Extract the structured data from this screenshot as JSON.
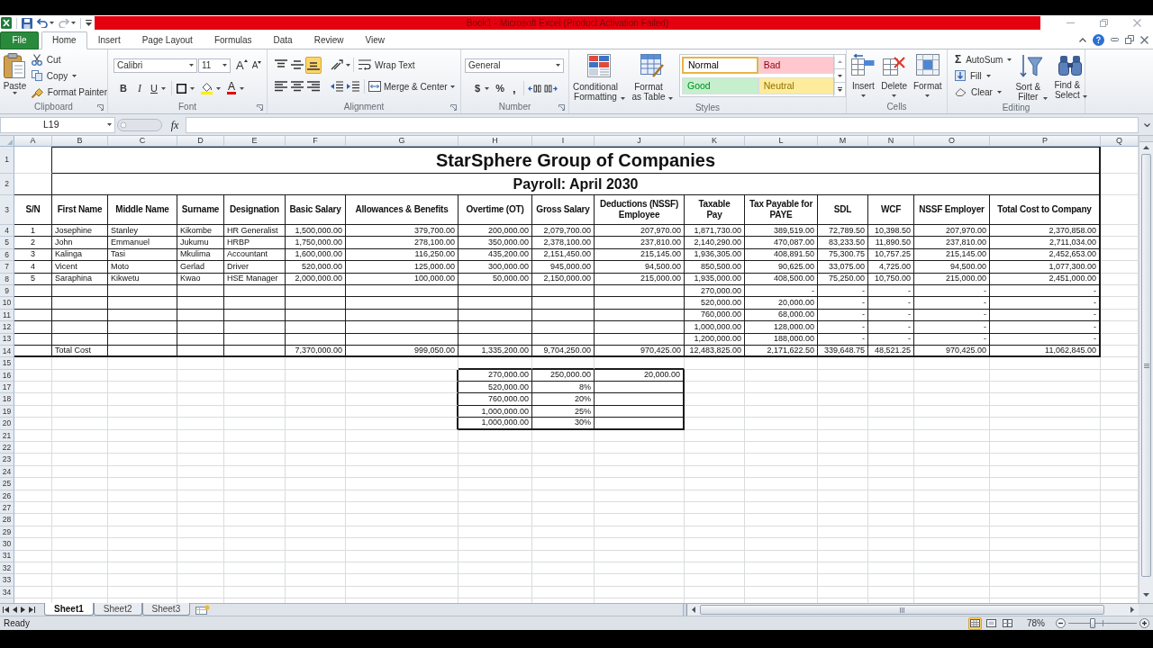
{
  "title_bar": {
    "title": "Book1 - Microsoft Excel (Product Activation Failed)",
    "quick_access": {
      "redo": {
        "disabled": true
      }
    }
  },
  "ribbon": {
    "tabs": [
      {
        "label": "File",
        "kind": "file",
        "selected": false
      },
      {
        "label": "Home",
        "kind": "tab",
        "selected": true
      },
      {
        "label": "Insert",
        "kind": "tab",
        "selected": false
      },
      {
        "label": "Page Layout",
        "kind": "tab",
        "selected": false
      },
      {
        "label": "Formulas",
        "kind": "tab",
        "selected": false
      },
      {
        "label": "Data",
        "kind": "tab",
        "selected": false
      },
      {
        "label": "Review",
        "kind": "tab",
        "selected": false
      },
      {
        "label": "View",
        "kind": "tab",
        "selected": false
      }
    ],
    "clipboard": {
      "label": "Clipboard",
      "paste": "Paste",
      "cut": "Cut",
      "copy": "Copy",
      "format_painter": "Format Painter"
    },
    "font": {
      "label": "Font",
      "font_name": "Calibri",
      "font_size": "11",
      "grow_font": "A",
      "shrink_font": "A",
      "bold": "B",
      "italic": "I",
      "underline": "U",
      "font_color": "A"
    },
    "alignment": {
      "label": "Alignment",
      "vertical_align": [
        {
          "selected": false
        },
        {
          "selected": false
        },
        {
          "selected": true
        }
      ],
      "wrap_text": "Wrap Text",
      "merge_center": "Merge & Center"
    },
    "number": {
      "label": "Number",
      "format": "General",
      "currency": "$",
      "percent": "%",
      "comma": ","
    },
    "styles": {
      "label": "Styles",
      "conditional_formatting": "Conditional Formatting",
      "format_as_table": "Format as Table",
      "gallery": [
        {
          "name": "Normal",
          "color": "#ffffff",
          "selected": true
        },
        {
          "name": "Bad",
          "color": "#ffc7ce",
          "selected": false
        },
        {
          "name": "Good",
          "color": "#c6efce",
          "selected": false
        },
        {
          "name": "Neutral",
          "color": "#ffeb9c",
          "selected": false
        }
      ]
    },
    "cells": {
      "label": "Cells",
      "buttons": [
        "Insert",
        "Delete",
        "Format"
      ]
    },
    "editing": {
      "label": "Editing",
      "sum_symbol": "Σ",
      "autosum": "AutoSum",
      "fill": "Fill",
      "clear": "Clear",
      "sort_filter": "Sort & Filter",
      "find_select": "Find & Select"
    }
  },
  "formula_bar": {
    "name_box": "L19",
    "fx": "fx"
  },
  "sheet": {
    "column_headers": [
      "A",
      "B",
      "C",
      "D",
      "E",
      "F",
      "G",
      "H",
      "I",
      "J",
      "K",
      "L",
      "M",
      "N",
      "O",
      "P",
      "Q"
    ],
    "row_headers": [
      "1",
      "2",
      "3",
      "4",
      "5",
      "6",
      "7",
      "8",
      "9",
      "10",
      "11",
      "12",
      "13",
      "14",
      "15",
      "16",
      "17",
      "18",
      "19",
      "20",
      "21",
      "22",
      "23",
      "24",
      "25",
      "26",
      "27",
      "28",
      "29",
      "30",
      "31",
      "32",
      "33",
      "34"
    ],
    "payroll": {
      "title": "StarSphere Group of Companies",
      "subtitle": "Payroll: April 2030",
      "headers": [
        "S/N",
        "First Name",
        "Middle Name",
        "Surname",
        "Designation",
        "Basic Salary",
        "Allowances & Benefits",
        "Overtime (OT)",
        "Gross Salary",
        "Deductions (NSSF) Employee",
        "Taxable Pay",
        "Tax Payable for PAYE",
        "SDL",
        "WCF",
        "NSSF Employer",
        "Total Cost to Company"
      ],
      "rows": [
        {
          "sn": "1",
          "first_name": "Josephine",
          "middle_name": "Stanley",
          "surname": "Kikombe",
          "designation": "HR Generalist",
          "basic_salary": "1,500,000.00",
          "allowances_benefits": "379,700.00",
          "overtime": "200,000.00",
          "gross_salary": "2,079,700.00",
          "nssf_employee": "207,970.00",
          "taxable_pay": "1,871,730.00",
          "paye": "389,519.00",
          "sdl": "72,789.50",
          "wcf": "10,398.50",
          "nssf_employer": "207,970.00",
          "total_cost": "2,370,858.00"
        },
        {
          "sn": "2",
          "first_name": "John",
          "middle_name": "Emmanuel",
          "surname": "Jukumu",
          "designation": "HRBP",
          "basic_salary": "1,750,000.00",
          "allowances_benefits": "278,100.00",
          "overtime": "350,000.00",
          "gross_salary": "2,378,100.00",
          "nssf_employee": "237,810.00",
          "taxable_pay": "2,140,290.00",
          "paye": "470,087.00",
          "sdl": "83,233.50",
          "wcf": "11,890.50",
          "nssf_employer": "237,810.00",
          "total_cost": "2,711,034.00"
        },
        {
          "sn": "3",
          "first_name": "Kalinga",
          "middle_name": "Tasi",
          "surname": "Mkulima",
          "designation": "Accountant",
          "basic_salary": "1,600,000.00",
          "allowances_benefits": "116,250.00",
          "overtime": "435,200.00",
          "gross_salary": "2,151,450.00",
          "nssf_employee": "215,145.00",
          "taxable_pay": "1,936,305.00",
          "paye": "408,891.50",
          "sdl": "75,300.75",
          "wcf": "10,757.25",
          "nssf_employer": "215,145.00",
          "total_cost": "2,452,653.00"
        },
        {
          "sn": "4",
          "first_name": "Vicent",
          "middle_name": "Moto",
          "surname": "Gerlad",
          "designation": "Driver",
          "basic_salary": "520,000.00",
          "allowances_benefits": "125,000.00",
          "overtime": "300,000.00",
          "gross_salary": "945,000.00",
          "nssf_employee": "94,500.00",
          "taxable_pay": "850,500.00",
          "paye": "90,625.00",
          "sdl": "33,075.00",
          "wcf": "4,725.00",
          "nssf_employer": "94,500.00",
          "total_cost": "1,077,300.00"
        },
        {
          "sn": "5",
          "first_name": "Saraphina",
          "middle_name": "Kikwetu",
          "surname": "Kwao",
          "designation": "HSE Manager",
          "basic_salary": "2,000,000.00",
          "allowances_benefits": "100,000.00",
          "overtime": "50,000.00",
          "gross_salary": "2,150,000.00",
          "nssf_employee": "215,000.00",
          "taxable_pay": "1,935,000.00",
          "paye": "408,500.00",
          "sdl": "75,250.00",
          "wcf": "10,750.00",
          "nssf_employer": "215,000.00",
          "total_cost": "2,451,000.00"
        },
        {
          "taxable_pay": "270,000.00",
          "paye": "-",
          "sdl": "-",
          "wcf": "-",
          "nssf_employer": "-",
          "total_cost": "-"
        },
        {
          "taxable_pay": "520,000.00",
          "paye": "20,000.00",
          "sdl": "-",
          "wcf": "-",
          "nssf_employer": "-",
          "total_cost": "-"
        },
        {
          "taxable_pay": "760,000.00",
          "paye": "68,000.00",
          "sdl": "-",
          "wcf": "-",
          "nssf_employer": "-",
          "total_cost": "-"
        },
        {
          "taxable_pay": "1,000,000.00",
          "paye": "128,000.00",
          "sdl": "-",
          "wcf": "-",
          "nssf_employer": "-",
          "total_cost": "-"
        },
        {
          "taxable_pay": "1,200,000.00",
          "paye": "188,000.00",
          "sdl": "-",
          "wcf": "-",
          "nssf_employer": "-",
          "total_cost": "-"
        }
      ],
      "total": {
        "label": "Total Cost",
        "basic_salary": "7,370,000.00",
        "allowances_benefits": "999,050.00",
        "overtime": "1,335,200.00",
        "gross_salary": "9,704,250.00",
        "nssf_employee": "970,425.00",
        "taxable_pay": "12,483,825.00",
        "paye": "2,171,622.50",
        "sdl": "339,648.75",
        "wcf": "48,521.25",
        "nssf_employer": "970,425.00",
        "total_cost": "11,062,845.00"
      }
    },
    "rate_table": {
      "rows": [
        {
          "cells": [
            "270,000.00",
            "250,000.00",
            "20,000.00"
          ]
        },
        {
          "cells": [
            "520,000.00",
            "8%"
          ]
        },
        {
          "cells": [
            "760,000.00",
            "20%"
          ]
        },
        {
          "cells": [
            "1,000,000.00",
            "25%"
          ]
        },
        {
          "cells": [
            "1,000,000.00",
            "30%"
          ]
        }
      ]
    }
  },
  "sheet_tabs": [
    {
      "label": "Sheet1",
      "selected": true
    },
    {
      "label": "Sheet2",
      "selected": false
    },
    {
      "label": "Sheet3",
      "selected": false
    }
  ],
  "status_bar": {
    "status": "Ready",
    "view_buttons": [
      {
        "selected": true
      },
      {
        "selected": false
      },
      {
        "selected": false
      }
    ],
    "zoom": "78%",
    "zoom_slider": {
      "level": 0.36
    }
  }
}
